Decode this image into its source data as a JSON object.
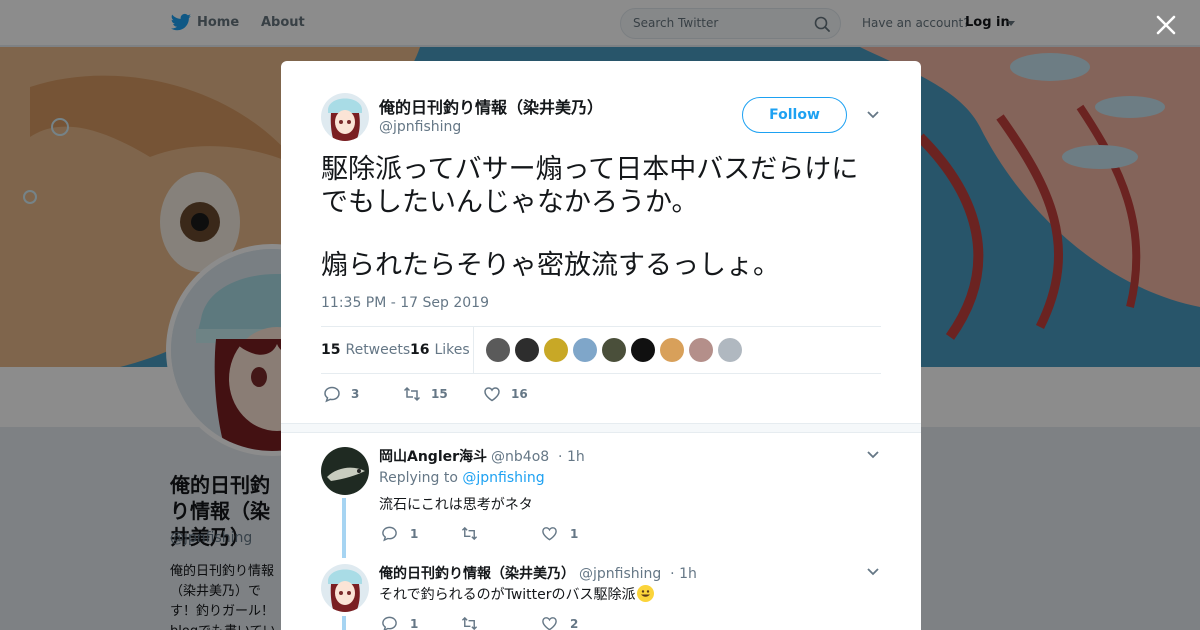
{
  "nav": {
    "home": "Home",
    "about": "About",
    "search_placeholder": "Search Twitter",
    "have_account": "Have an account?",
    "login": "Log in"
  },
  "profile_bg": {
    "name": "俺的日刊釣り情報（染井美乃）",
    "handle": "@jpnfishing",
    "bio": "俺的日刊釣り情報（染井美乃）です！釣りガール！blogでも書いています"
  },
  "tweet": {
    "author_name": "俺的日刊釣り情報（染井美乃）",
    "author_handle": "@jpnfishing",
    "follow_label": "Follow",
    "text_line1": "駆除派ってバサー煽って日本中バスだらけに",
    "text_line2": "でもしたいんじゃなかろうか。",
    "text_line3": "煽られたらそりゃ密放流するっしょ。",
    "timestamp": "11:35 PM - 17 Sep 2019",
    "retweets_count": "15",
    "retweets_label": "Retweets",
    "likes_count": "16",
    "likes_label": "Likes",
    "action_replies": "3",
    "action_retweets": "15",
    "action_likes": "16",
    "liker_avatar_colors": [
      "#5a5a5a",
      "#2d2d2d",
      "#c8a826",
      "#7fa6c9",
      "#4a4f3a",
      "#101010",
      "#d8a05a",
      "#b48f8a",
      "#b0b8c0"
    ]
  },
  "replies": [
    {
      "name": "岡山Angler海斗",
      "handle": "@nb4o8",
      "time": "· 1h",
      "replying_prefix": "Replying to",
      "replying_to": "@jpnfishing",
      "text": "流石にこれは思考がネタ",
      "replies": "1",
      "retweets": "",
      "likes": "1"
    },
    {
      "name": "俺的日刊釣り情報（染井美乃）",
      "handle": "@jpnfishing",
      "time": "· 1h",
      "text": "それで釣られるのがTwitterのバス駆除派",
      "replies": "1",
      "retweets": "",
      "likes": "2"
    }
  ],
  "colors": {
    "accent": "#1da1f2",
    "overlay": "rgba(0,0,0,0.45)",
    "thread_line": "#a6d4f2"
  }
}
